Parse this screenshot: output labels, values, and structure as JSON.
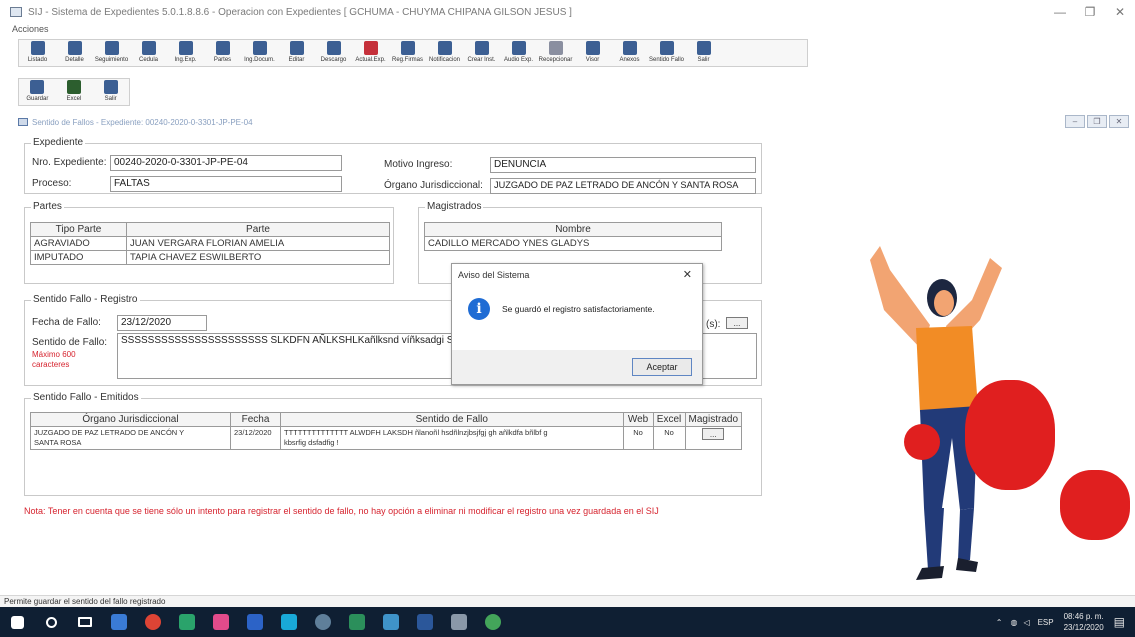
{
  "window": {
    "title": "SIJ - Sistema de Expedientes 5.0.1.8.8.6 - Operacion con Expedientes [ GCHUMA - CHUYMA CHIPANA GILSON JESUS ]",
    "min_icon": "minimize-icon",
    "max_icon": "maximize-icon",
    "close_icon": "close-icon"
  },
  "menu": {
    "acciones": "Acciones"
  },
  "toolbar1": [
    {
      "label": "Listado",
      "icon": "list-icon",
      "color": "#3c5f93"
    },
    {
      "label": "Detalle",
      "icon": "detail-icon",
      "color": "#3c5f93"
    },
    {
      "label": "Seguimiento",
      "icon": "tracking-icon",
      "color": "#3c5f93"
    },
    {
      "label": "Cedula",
      "icon": "cedula-icon",
      "color": "#3c5f93"
    },
    {
      "label": "Ing.Exp.",
      "icon": "entry-icon",
      "color": "#3c5f93"
    },
    {
      "label": "Partes",
      "icon": "parties-icon",
      "color": "#3c5f93"
    },
    {
      "label": "Ing.Docum.",
      "icon": "doc-entry-icon",
      "color": "#3c5f93"
    },
    {
      "label": "Editar",
      "icon": "edit-icon",
      "color": "#3c5f93"
    },
    {
      "label": "Descargo",
      "icon": "discharge-icon",
      "color": "#3c5f93"
    },
    {
      "label": "Actual.Exp.",
      "icon": "update-icon",
      "color": "#c5303a"
    },
    {
      "label": "Reg.Firmas",
      "icon": "signatures-icon",
      "color": "#3c5f93"
    },
    {
      "label": "Notificacion",
      "icon": "notification-icon",
      "color": "#3c5f93"
    },
    {
      "label": "Crear Inst.",
      "icon": "create-icon",
      "color": "#3c5f93"
    },
    {
      "label": "Audio Exp.",
      "icon": "audio-icon",
      "color": "#3c5f93"
    },
    {
      "label": "Recepcionar",
      "icon": "receive-icon",
      "color": "#8a8fa0"
    },
    {
      "label": "Visor",
      "icon": "viewer-icon",
      "color": "#3c5f93"
    },
    {
      "label": "Anexos",
      "icon": "attachments-icon",
      "color": "#3c5f93"
    },
    {
      "label": "Sentido Fallo",
      "icon": "verdict-icon",
      "color": "#3c5f93"
    },
    {
      "label": "Salir",
      "icon": "exit-icon",
      "color": "#3c5f93"
    }
  ],
  "toolbar2": [
    {
      "label": "Guardar",
      "icon": "save-icon",
      "color": "#3c5f93"
    },
    {
      "label": "Excel",
      "icon": "excel-icon",
      "color": "#2c5e2e"
    },
    {
      "label": "Salir",
      "icon": "exit-icon",
      "color": "#3c5f93"
    }
  ],
  "child_window": {
    "title": "Sentido de Fallos - Expediente: 00240-2020-0-3301-JP-PE-04"
  },
  "expediente": {
    "legend": "Expediente",
    "nro_label": "Nro. Expediente:",
    "nro_value": "00240-2020-0-3301-JP-PE-04",
    "proceso_label": "Proceso:",
    "proceso_value": "FALTAS",
    "motivo_label": "Motivo Ingreso:",
    "motivo_value": "DENUNCIA",
    "organo_label": "Órgano Jurisdiccional:",
    "organo_value": "JUZGADO DE PAZ LETRADO DE ANCÓN Y SANTA ROSA"
  },
  "partes": {
    "legend": "Partes",
    "headers": [
      "Tipo Parte",
      "Parte"
    ],
    "rows": [
      [
        "AGRAVIADO",
        "JUAN VERGARA FLORIAN AMELIA"
      ],
      [
        "IMPUTADO",
        "TAPIA CHAVEZ ESWILBERTO"
      ]
    ]
  },
  "magistrados": {
    "legend": "Magistrados",
    "header": "Nombre",
    "rows": [
      "CADILLO MERCADO YNES GLADYS"
    ]
  },
  "registro": {
    "legend": "Sentido Fallo - Registro",
    "fecha_label": "Fecha de Fallo:",
    "fecha_value": "23/12/2020",
    "sentido_label": "Sentido de Fallo:",
    "sentido_hint1": "Máximo 600",
    "sentido_hint2": "caracteres",
    "sentido_value": "SSSSSSSSSSSSSSSSSSSSSS SLKDFN AÑLKSHLKañlksnd víñksadgi S",
    "extra_label": "(s):",
    "extra_btn": "..."
  },
  "emitidos": {
    "legend": "Sentido Fallo - Emitidos",
    "headers": [
      "Órgano Jurisdiccional",
      "Fecha",
      "Sentido de Fallo",
      "Web",
      "Excel",
      "Magistrado"
    ],
    "rows": [
      {
        "organo_1": "JUZGADO DE PAZ LETRADO DE ANCÓN Y",
        "organo_2": "SANTA ROSA",
        "fecha": "23/12/2020",
        "sentido_1": "TTTTTTTTTTTTTT ALWDFH LAKSDH ñlanoñl hsdñlnzjbsjfgj gh añlkdfa bñlbf g",
        "sentido_2": "kbsrfig dsfadfig !",
        "web": "No",
        "excel": "No",
        "magistrado": "..."
      }
    ]
  },
  "nota": "Nota: Tener en cuenta que se tiene sólo un intento para registrar el sentido de fallo, no hay opción a eliminar ni modificar el registro una vez guardada en  el SIJ",
  "dialog": {
    "title": "Aviso del Sistema",
    "message": "Se guardó el registro satisfactoriamente.",
    "ok": "Aceptar",
    "icon": "info-icon"
  },
  "status": "Permite guardar el sentido del fallo registrado",
  "tray": {
    "lang": "ESP",
    "time": "08:46 p. m.",
    "date": "23/12/2020"
  },
  "colors": {
    "accent_red": "#d6242f",
    "taskbar": "#0f1f33",
    "info_blue": "#1f6cd4"
  }
}
